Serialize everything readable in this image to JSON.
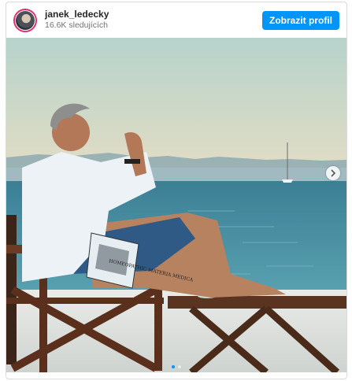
{
  "post": {
    "username": "janek_ledecky",
    "followers": "16.6K sledujících",
    "profile_button": "Zobrazit profil"
  },
  "carousel": {
    "slide_count": 2,
    "active_slide": 1,
    "next_icon": "chevron-right-icon"
  },
  "book": {
    "cover_text": "HOMEOPATHIC MATERIA MEDICA"
  },
  "colors": {
    "accent": "#0095f6",
    "story_ring": "#e1306c"
  }
}
